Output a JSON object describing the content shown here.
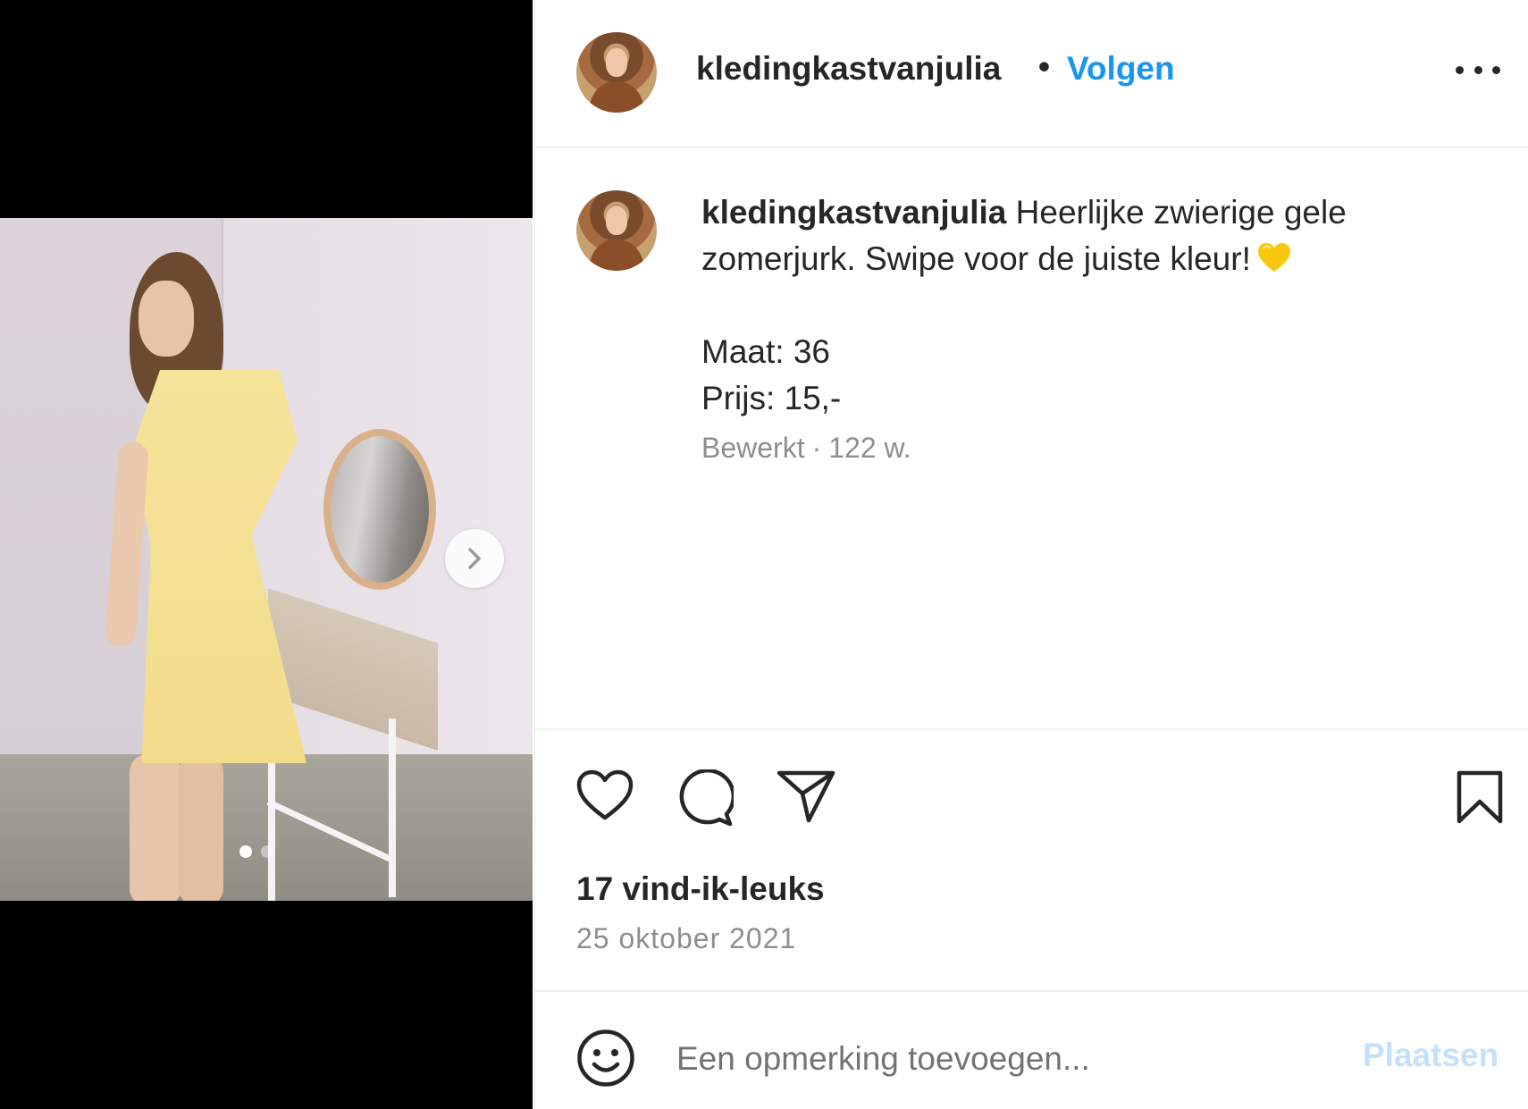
{
  "post": {
    "username": "kledingkastvanjulia",
    "separator": "•",
    "follow_label": "Volgen",
    "more_icon": "more-horizontal-icon",
    "caption_text_line1": "Heerlijke zwierige gele",
    "caption_text_line2": "zomerjurk. Swipe voor de juiste kleur!",
    "caption_emoji": "yellow-heart-icon",
    "size_line": "Maat: 36",
    "price_line": "Prijs: 15,-",
    "edited_label": "Bewerkt",
    "meta_separator": "·",
    "age": "122 w.",
    "likes": "17 vind-ik-leuks",
    "date": "25 oktober 2021",
    "carousel": {
      "current": 1,
      "total": 2
    }
  },
  "actions": {
    "like_icon": "heart-icon",
    "comment_icon": "comment-icon",
    "share_icon": "send-icon",
    "save_icon": "bookmark-icon"
  },
  "comment": {
    "emoji_icon": "smiley-icon",
    "placeholder": "Een opmerking toevoegen...",
    "post_label": "Plaatsen"
  },
  "colors": {
    "accent": "#1a95f0",
    "post_disabled": "#c4e1fb",
    "text": "#262626",
    "muted": "#8e8e8e",
    "heart_emoji": "#f9c80e"
  }
}
